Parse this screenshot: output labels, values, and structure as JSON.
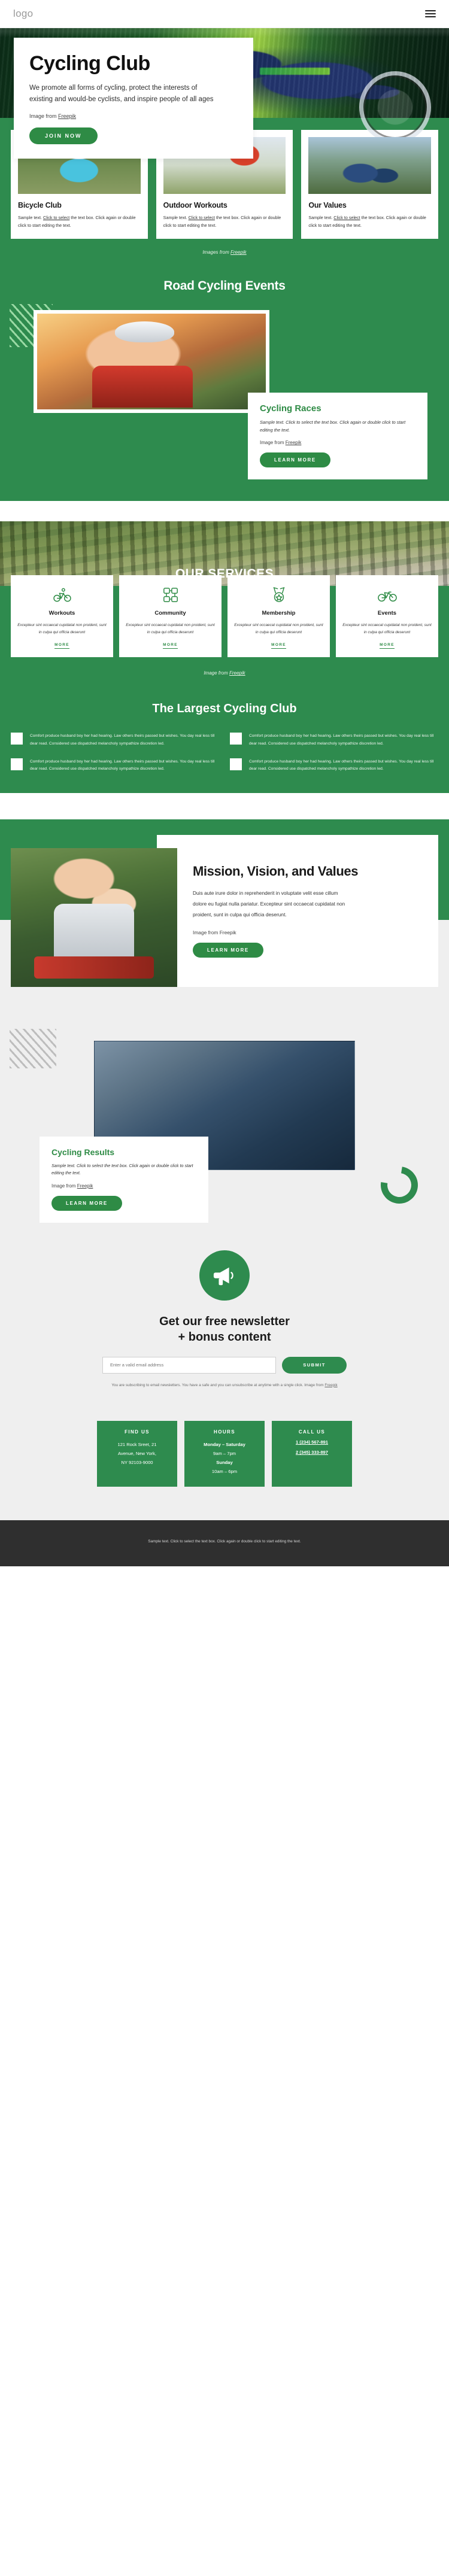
{
  "header": {
    "logo": "logo",
    "menu_icon": "hamburger-menu-icon"
  },
  "hero": {
    "title": "Cycling Club",
    "lead": "We promote all forms of cycling, protect the interests of existing and would-be cyclists, and inspire people of all ages",
    "credit_prefix": "Image from ",
    "credit_link": "Freepik",
    "cta": "JOIN NOW"
  },
  "cards3": {
    "items": [
      {
        "title": "Bicycle Club",
        "text_a": "Sample text. ",
        "text_b": "Click to select",
        "text_c": " the text box. Click again or double click to start editing the text."
      },
      {
        "title": "Outdoor Workouts",
        "text_a": "Sample text. ",
        "text_b": "Click to select",
        "text_c": " the text box. Click again or double click to start editing the text."
      },
      {
        "title": "Our Values",
        "text_a": "Sample text. ",
        "text_b": "Click to select",
        "text_c": " the text box. Click again or double click to start editing the text."
      }
    ],
    "credit_prefix": "Images from ",
    "credit_link": "Freepik"
  },
  "events": {
    "section_title": "Road Cycling Events",
    "card_title": "Cycling Races",
    "card_text": "Sample text. Click to select the text box. Click again or double click to start editing the text.",
    "credit_prefix": "Image from ",
    "credit_link": "Freepik",
    "cta": "LEARN MORE"
  },
  "services": {
    "section_title": "OUR SERVICES",
    "body": "Excepteur sint occaecat cupidatat non proident, sunt in culpa qui officia deserunt",
    "more_label": "MORE",
    "items": [
      {
        "title": "Workouts",
        "icon": "cyclist-icon"
      },
      {
        "title": "Community",
        "icon": "teamwork-hands-icon"
      },
      {
        "title": "Membership",
        "icon": "medal-icon"
      },
      {
        "title": "Events",
        "icon": "bicycle-icon"
      }
    ],
    "credit_prefix": "Image from ",
    "credit_link": "Freepik"
  },
  "largest": {
    "title": "The Largest Cycling Club",
    "items": [
      "Comfort produce husband boy her had hearing. Law others theirs passed but wishes. You day real less till dear read. Considered use dispatched melancholy sympathize discretion led.",
      "Comfort produce husband boy her had hearing. Law others theirs passed but wishes. You day real less till dear read. Considered use dispatched melancholy sympathize discretion led.",
      "Comfort produce husband boy her had hearing. Law others theirs passed but wishes. You day real less till dear read. Considered use dispatched melancholy sympathize discretion led.",
      "Comfort produce husband boy her had hearing. Law others theirs passed but wishes. You day real less till dear read. Considered use dispatched melancholy sympathize discretion led."
    ]
  },
  "mission": {
    "title": "Mission, Vision, and Values",
    "body": "Duis aute irure dolor in reprehenderit in voluptate velit esse cillum dolore eu fugiat nulla pariatur. Excepteur sint occaecat cupidatat non proident, sunt in culpa qui officia deserunt.",
    "credit_prefix": "Image from ",
    "credit_link": "Freepik",
    "cta": "LEARN MORE"
  },
  "results": {
    "title": "Cycling Results",
    "text": "Sample text. Click to select the text box. Click again or double click to start editing the text.",
    "credit_prefix": "Image from ",
    "credit_link": "Freepik",
    "cta": "LEARN MORE"
  },
  "newsletter": {
    "icon": "megaphone-icon",
    "title_line1": "Get our free newsletter",
    "title_line2": "+ bonus content",
    "input_placeholder": "Enter a valid email address",
    "input_value": "",
    "submit": "SUBMIT",
    "note_a": "You are subscribing to email newsletters. You have a safe and you can unsubscribe at anytime with a single click. Image from ",
    "note_link": "Freepik"
  },
  "footer_boxes": [
    {
      "title": "FIND US",
      "lines": [
        "121 Rock Sreet, 21",
        "Avenue, New York,",
        "NY 92103-9000"
      ],
      "links": []
    },
    {
      "title": "HOURS",
      "lines": [
        "Monday – Saturday",
        "9am – 7pm",
        "Sunday",
        "10am – 6pm"
      ],
      "links": []
    },
    {
      "title": "CALL US",
      "lines": [],
      "links": [
        "1 (234) 567-891",
        "2 (345) 333-897"
      ]
    }
  ],
  "bottom": {
    "text": "Sample text. Click to select the text box. Click again or double click to start editing the text."
  },
  "colors": {
    "brand_green": "#2e8b4e",
    "btn_green": "#2e8b45",
    "light_gray": "#efefef",
    "dark_bar": "#2f2f2f"
  }
}
